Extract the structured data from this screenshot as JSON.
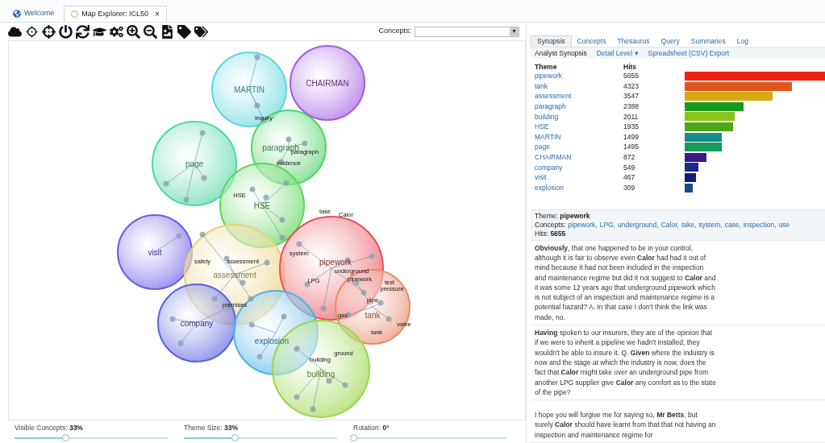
{
  "tabs": [
    {
      "label": "Welcome",
      "selected": false,
      "closable": false
    },
    {
      "label": "Map Explorer: ICL50",
      "selected": true,
      "closable": true
    }
  ],
  "close_glyph": "×",
  "concepts_select": {
    "label": "Concepts:",
    "caret": "▼"
  },
  "map": {
    "bubbles": [
      {
        "label": "MARTIN",
        "color": "#5fd6dc",
        "concepts": [
          "inquiry"
        ]
      },
      {
        "label": "CHAIRMAN",
        "color": "#a25ce0"
      },
      {
        "label": "page",
        "color": "#52d6a4"
      },
      {
        "label": "paragraph",
        "color": "#4fd46a",
        "concepts": [
          "paragraph",
          "evidence"
        ]
      },
      {
        "label": "HSE",
        "color": "#5cd65a",
        "concepts": [
          "HSE"
        ]
      },
      {
        "label": "visit",
        "color": "#6a5ce6"
      },
      {
        "label": "assessment",
        "color": "#e8d078",
        "concepts": [
          "safety",
          "assessment",
          "premises"
        ]
      },
      {
        "label": "pipework",
        "color": "#e8505a",
        "concepts": [
          "take",
          "Calor",
          "system",
          "underground",
          "pipework",
          "LPG"
        ]
      },
      {
        "label": "company",
        "color": "#5a62e0"
      },
      {
        "label": "explosion",
        "color": "#4fb2e6"
      },
      {
        "label": "tank",
        "color": "#e88a6a",
        "concepts": [
          "test",
          "pressure",
          "pipe",
          "gas",
          "tank",
          "valve"
        ]
      },
      {
        "label": "building",
        "color": "#9ad64a",
        "concepts": [
          "ground",
          "building"
        ]
      }
    ]
  },
  "sliders": [
    {
      "label": "Visible Concepts:",
      "value": "33%",
      "level": 0.33
    },
    {
      "label": "Theme Size:",
      "value": "33%",
      "level": 0.33
    },
    {
      "label": "Rotation:",
      "value": "0°",
      "level": 0
    }
  ],
  "panel_tabs": [
    {
      "label": "Synopsis",
      "selected": true
    },
    {
      "label": "Concepts",
      "selected": false
    },
    {
      "label": "Thesaurus",
      "selected": false
    },
    {
      "label": "Query",
      "selected": false
    },
    {
      "label": "Summaries",
      "selected": false
    },
    {
      "label": "Log",
      "selected": false
    }
  ],
  "synopsis_bar": {
    "title": "Analyst Synopsis",
    "detail": "Detail Level",
    "caret": "▾",
    "export": "Spreadsheet (CSV) Export"
  },
  "theme_table": {
    "columns": [
      "Theme",
      "Hits"
    ],
    "rows": [
      {
        "theme": "pipework",
        "hits": "5655",
        "color": "#f01e12"
      },
      {
        "theme": "tank",
        "hits": "4323",
        "color": "#e0551a"
      },
      {
        "theme": "assessment",
        "hits": "3547",
        "color": "#d4aa10"
      },
      {
        "theme": "paragraph",
        "hits": "2388",
        "color": "#1a9a1a"
      },
      {
        "theme": "building",
        "hits": "2011",
        "color": "#8cc21a"
      },
      {
        "theme": "HSE",
        "hits": "1935",
        "color": "#4aa818"
      },
      {
        "theme": "MARTIN",
        "hits": "1499",
        "color": "#138e8a"
      },
      {
        "theme": "page",
        "hits": "1495",
        "color": "#159a5a"
      },
      {
        "theme": "CHAIRMAN",
        "hits": "872",
        "color": "#3a1a8a"
      },
      {
        "theme": "company",
        "hits": "549",
        "color": "#1a2a8a"
      },
      {
        "theme": "visit",
        "hits": "467",
        "color": "#141a78"
      },
      {
        "theme": "explosion",
        "hits": "309",
        "color": "#1a4a8a"
      }
    ]
  },
  "detail": {
    "theme_label": "Theme:",
    "theme": "pipework",
    "concepts_label": "Concepts:",
    "concepts": [
      "pipework",
      "LPG",
      "underground",
      "Calor",
      "take",
      "system",
      "case",
      "inspection",
      "use"
    ],
    "separator": ",",
    "hits_label": "Hits:",
    "hits": "5655"
  },
  "passages": [
    "**Obviously**, that one happened to be in your control, although it is fair to observe even **Calor** had had it out of mind because it had not been included in the inspection and maintenance regime but did it not suggest to **Calor** and it was some 12 years ago that underground pipework which is not subject of an inspection and maintenance regime is a potential hazard? A. In that case I don't think the link was made, no.",
    "**Having** spoken to our insurers, they are of the opinion that if we were to inherit a pipeline we hadn't installed, they wouldn't be able to insure it. Q. **Given** where the industry is now and the stage at which the industry is now, does the fact that **Calor** might take over an underground pipe from another LPG supplier give **Calor** any comfort as to the state of the pipe?",
    "I hope you will forgive me for saying so, **Mr Betts**, but surely **Calor** should have learnt from that that not having an inspection and maintenance regime for"
  ]
}
